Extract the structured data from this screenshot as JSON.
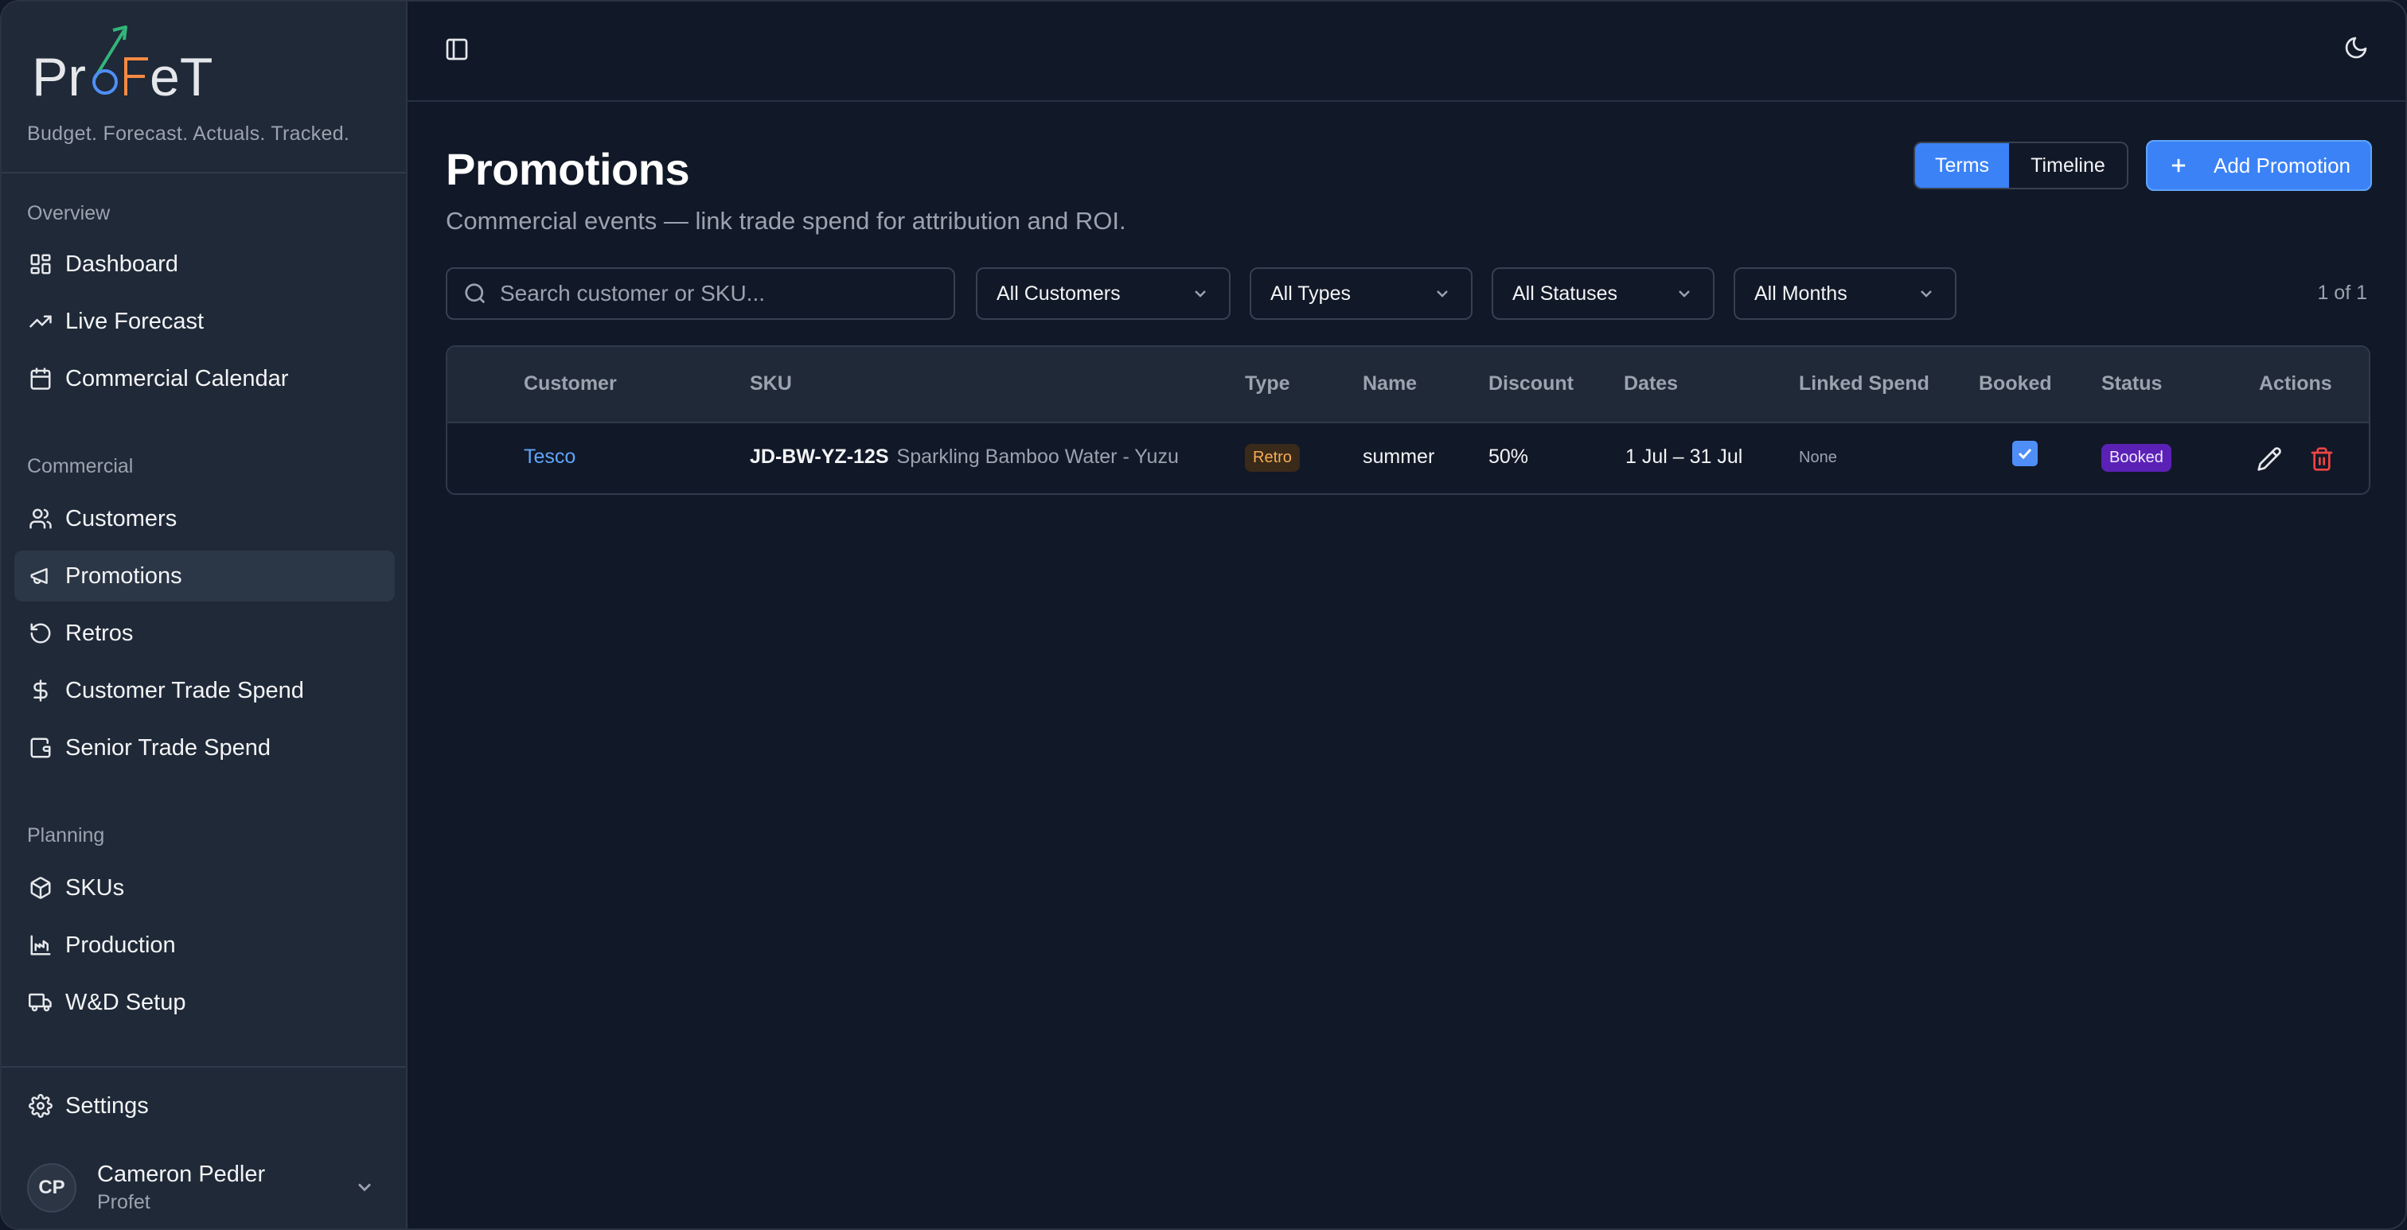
{
  "brand": {
    "logo_text": "ProFeT",
    "tagline": "Budget. Forecast. Actuals. Tracked."
  },
  "sidebar": {
    "sections": [
      {
        "label": "Overview",
        "items": [
          {
            "label": "Dashboard",
            "icon": "dashboard-icon"
          },
          {
            "label": "Live Forecast",
            "icon": "trend-up-icon"
          },
          {
            "label": "Commercial Calendar",
            "icon": "calendar-icon"
          }
        ]
      },
      {
        "label": "Commercial",
        "items": [
          {
            "label": "Customers",
            "icon": "users-icon"
          },
          {
            "label": "Promotions",
            "icon": "megaphone-icon",
            "active": true
          },
          {
            "label": "Retros",
            "icon": "rotate-ccw-icon"
          },
          {
            "label": "Customer Trade Spend",
            "icon": "dollar-icon"
          },
          {
            "label": "Senior Trade Spend",
            "icon": "wallet-icon"
          }
        ]
      },
      {
        "label": "Planning",
        "items": [
          {
            "label": "SKUs",
            "icon": "package-icon"
          },
          {
            "label": "Production",
            "icon": "factory-icon"
          },
          {
            "label": "W&D Setup",
            "icon": "truck-icon"
          }
        ]
      }
    ],
    "settings_label": "Settings",
    "user": {
      "initials": "CP",
      "name": "Cameron Pedler",
      "org": "Profet"
    }
  },
  "header": {
    "title": "Promotions",
    "subtitle": "Commercial events — link trade spend for attribution and ROI.",
    "view_tabs": [
      "Terms",
      "Timeline"
    ],
    "active_view": "Terms",
    "add_button_label": "Add Promotion"
  },
  "filters": {
    "search_placeholder": "Search customer or SKU...",
    "customers": "All Customers",
    "types": "All Types",
    "statuses": "All Statuses",
    "months": "All Months",
    "count": "1 of 1"
  },
  "table": {
    "columns": [
      "Customer",
      "SKU",
      "Type",
      "Name",
      "Discount",
      "Dates",
      "Linked Spend",
      "Booked",
      "Status",
      "Actions"
    ],
    "rows": [
      {
        "customer": "Tesco",
        "sku_code": "JD-BW-YZ-12S",
        "sku_name": "Sparkling Bamboo Water - Yuzu",
        "type": "Retro",
        "name": "summer",
        "discount": "50%",
        "dates": "1 Jul – 31 Jul",
        "linked_spend": "None",
        "booked": true,
        "status": "Booked"
      }
    ]
  },
  "colors": {
    "accent": "#3b82f6",
    "background": "#111827",
    "sidebar": "#1f2937",
    "retro_badge": "#f6ad55",
    "booked_badge": "#5b21b6",
    "delete": "#ef4444"
  }
}
